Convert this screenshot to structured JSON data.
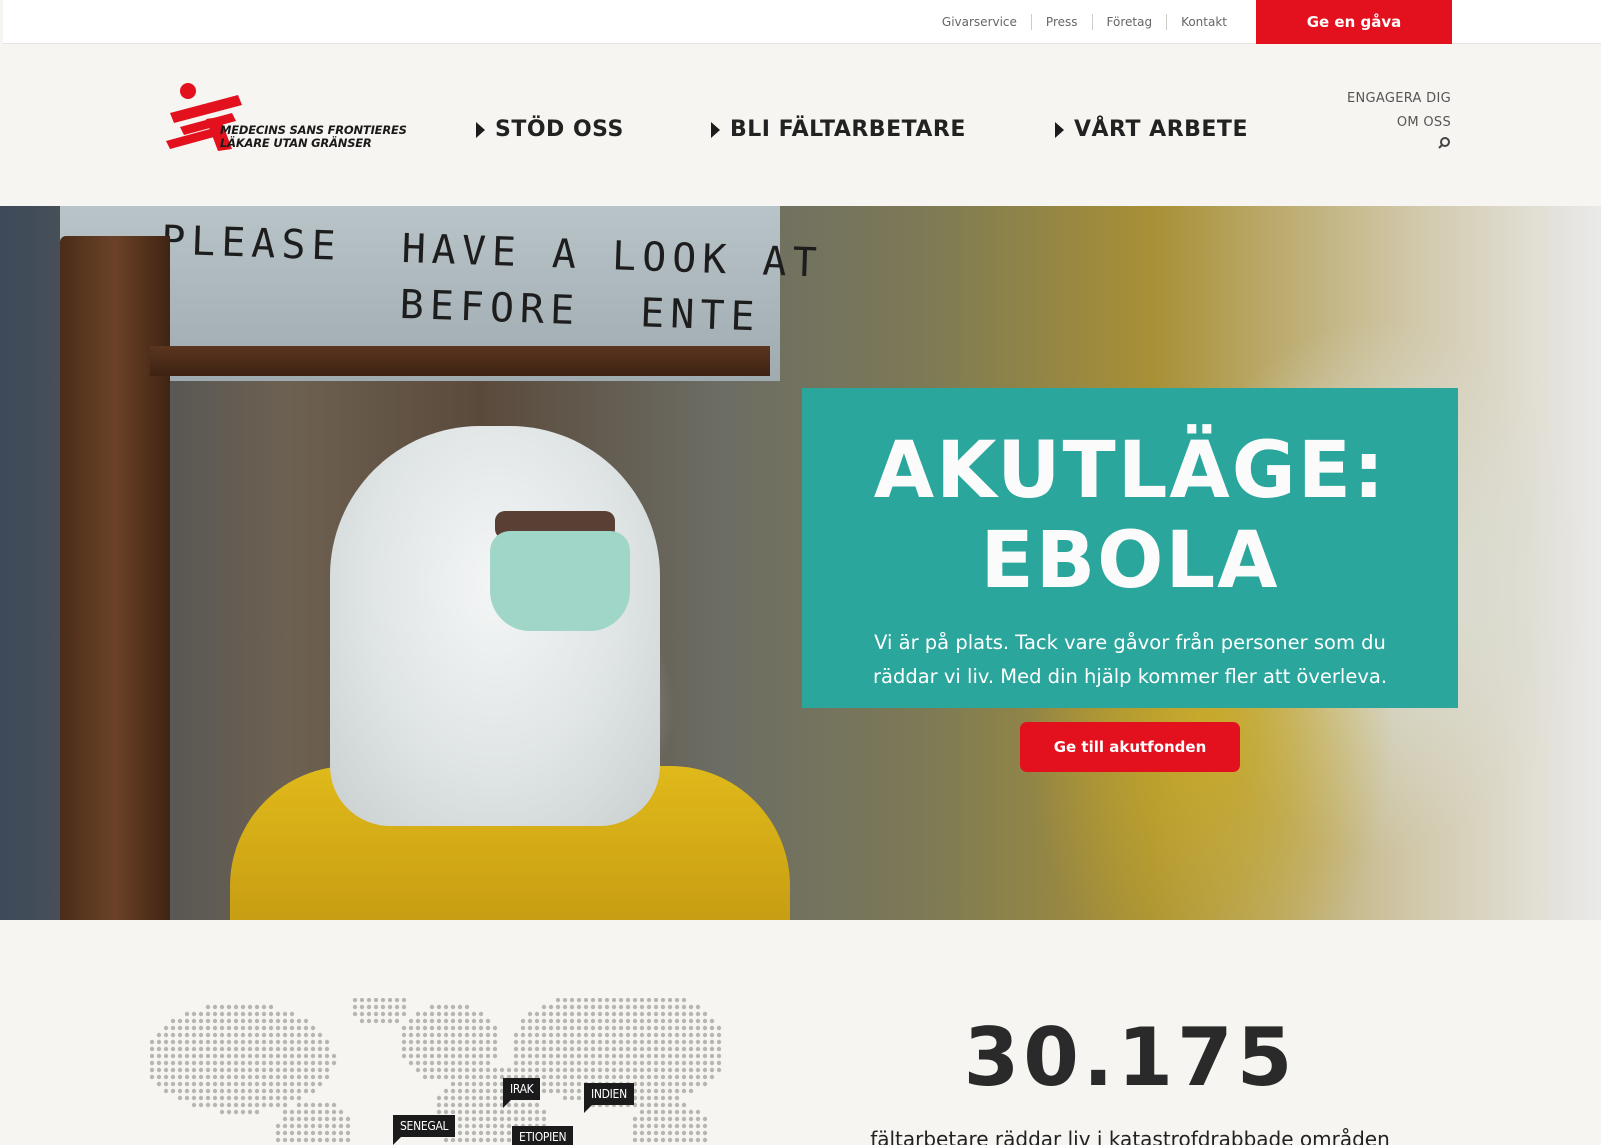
{
  "topbar": {
    "links": [
      "Givarservice",
      "Press",
      "Företag",
      "Kontakt"
    ],
    "donate_label": "Ge en gåva"
  },
  "brand": {
    "line1": "MEDECINS SANS FRONTIERES",
    "line2": "LÄKARE UTAN GRÄNSER",
    "color": "#e3101e"
  },
  "nav": {
    "items": [
      "STÖD OSS",
      "BLI FÄLTARBETARE",
      "VÅRT ARBETE"
    ],
    "secondary": [
      "ENGAGERA DIG",
      "OM OSS"
    ],
    "search_icon": "search-icon"
  },
  "hero": {
    "handwriting": "PLEASE  HAVE A LOOK AT\n        BEFORE  ENTE",
    "title": "AKUTLÄGE: EBOLA",
    "body": "Vi är på plats. Tack vare gåvor från personer som du räddar vi liv. Med din hjälp kommer fler att överleva.",
    "button_label": "Ge till akutfonden",
    "accent": "#2aa69c"
  },
  "map": {
    "tags": [
      "IRAK",
      "INDIEN",
      "SENEGAL",
      "ETIOPIEN"
    ]
  },
  "stats": {
    "number": "30.175",
    "caption": "fältarbetare räddar liv i katastrofdrabbade områden"
  }
}
